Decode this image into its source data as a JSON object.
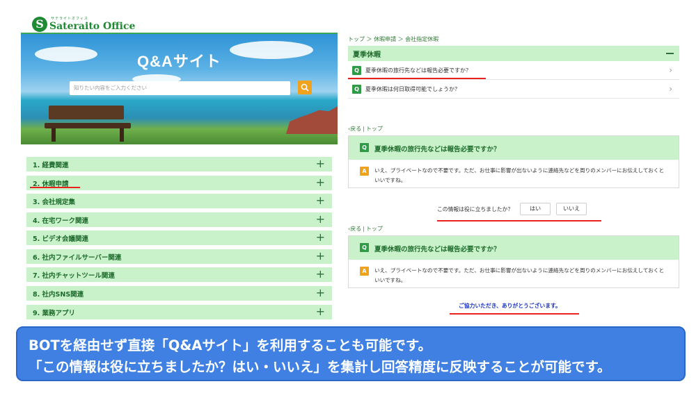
{
  "header": {
    "logo_mark": "S",
    "logo_sub": "サテライトオフィス",
    "logo_name": "Sateraito Office"
  },
  "hero": {
    "title": "Q&Aサイト",
    "search_placeholder": "知りたい内容をご入力ください",
    "search_icon": "search-icon"
  },
  "categories": [
    {
      "label": "1. 経費関連"
    },
    {
      "label": "2. 休暇申請"
    },
    {
      "label": "3. 会社規定集"
    },
    {
      "label": "4. 在宅ワーク関連"
    },
    {
      "label": "5. ビデオ会議関連"
    },
    {
      "label": "6. 社内ファイルサーバー関連"
    },
    {
      "label": "7. 社内チャットツール関連"
    },
    {
      "label": "8. 社内SNS関連"
    },
    {
      "label": "9. 業務アプリ"
    }
  ],
  "expand_symbol": "+",
  "breadcrumb": "トップ ＞ 休暇申請 ＞ 会社指定休暇",
  "section": {
    "title": "夏季休暇",
    "questions": [
      {
        "badge": "Q",
        "text": "夏季休暇の旅行先などは報告必要ですか？"
      },
      {
        "badge": "Q",
        "text": "夏季休暇は何日取得可能でしょうか？"
      }
    ]
  },
  "back_links": {
    "back": "‹戻る",
    "sep": "|",
    "top": "トップ"
  },
  "answer": {
    "q_badge": "Q",
    "question": "夏季休暇の旅行先などは報告必要ですか？",
    "a_badge": "A",
    "text": "いえ、プライベートなので不要です。ただ、お仕事に影響が出ないように連絡先などを周りのメンバーにお伝えしておくといいですね。"
  },
  "feedback": {
    "question": "この情報は役に立ちましたか？",
    "yes": "はい",
    "no": "いいえ"
  },
  "thanks": "ご協力いただき、ありがとうございます。",
  "banner": {
    "line1": "BOTを経由せず直接「Q&Aサイト」を利用することも可能です。",
    "line2": "「この情報は役に立ちましたか？はい・いいえ」を集計し回答精度に反映することが可能です。"
  },
  "colors": {
    "brand_green": "#1f8a34",
    "row_green": "#c9f2cb",
    "accent_orange": "#f0a21c",
    "underline_red": "#e8211d",
    "banner_blue": "#3f80e2",
    "thanks_blue": "#1a33c2"
  }
}
